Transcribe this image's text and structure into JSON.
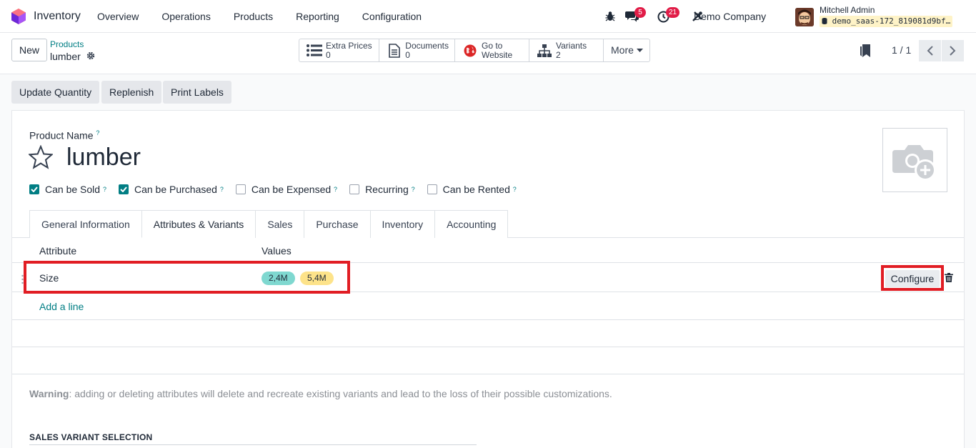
{
  "app": {
    "name": "Inventory"
  },
  "menu": [
    "Overview",
    "Operations",
    "Products",
    "Reporting",
    "Configuration"
  ],
  "systray": {
    "messages_count": "5",
    "activities_count": "21",
    "company": "Demo Company",
    "user_name": "Mitchell Admin",
    "db_name": "demo_saas-172_819081d9bf…"
  },
  "control": {
    "new_label": "New",
    "breadcrumb_parent": "Products",
    "breadcrumb_current": "lumber",
    "smart_buttons": [
      {
        "label": "Extra Prices",
        "value": "0",
        "icon": "list-icon"
      },
      {
        "label": "Documents",
        "value": "0",
        "icon": "document-icon"
      },
      {
        "label": "Go to",
        "value": "Website",
        "icon": "globe-icon"
      },
      {
        "label": "Variants",
        "value": "2",
        "icon": "sitemap-icon"
      }
    ],
    "more_label": "More",
    "pager": "1 / 1"
  },
  "actions": [
    "Update Quantity",
    "Replenish",
    "Print Labels"
  ],
  "form": {
    "product_name_label": "Product Name",
    "help_mark": "?",
    "product_name": "lumber",
    "checkboxes": [
      {
        "label": "Can be Sold",
        "checked": true
      },
      {
        "label": "Can be Purchased",
        "checked": true
      },
      {
        "label": "Can be Expensed",
        "checked": false
      },
      {
        "label": "Recurring",
        "checked": false
      },
      {
        "label": "Can be Rented",
        "checked": false
      }
    ],
    "tabs": [
      "General Information",
      "Attributes & Variants",
      "Sales",
      "Purchase",
      "Inventory",
      "Accounting"
    ],
    "active_tab": "Attributes & Variants",
    "table": {
      "headers": [
        "Attribute",
        "Values"
      ],
      "rows": [
        {
          "attribute": "Size",
          "values": [
            {
              "label": "2,4M",
              "color": "#7fd8d0"
            },
            {
              "label": "5,4M",
              "color": "#fde38a"
            }
          ]
        }
      ],
      "configure_label": "Configure",
      "add_line_label": "Add a line"
    },
    "warning_bold": "Warning",
    "warning_text": ": adding or deleting attributes will delete and recreate existing variants and lead to the loss of their possible customizations.",
    "section_title": "SALES VARIANT SELECTION"
  },
  "colors": {
    "accent": "#017e84",
    "highlight": "#e11d24"
  }
}
